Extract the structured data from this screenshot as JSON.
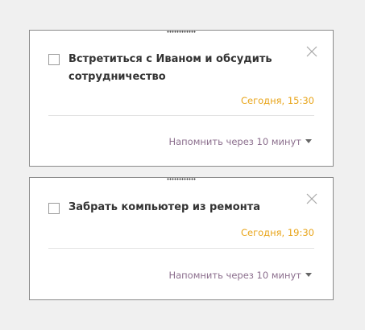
{
  "reminders": [
    {
      "title": "Встретиться с Иваном и обсудить сотрудничество",
      "time": "Сегодня, 15:30",
      "remind_label": "Напомнить через 10 минут",
      "checked": false
    },
    {
      "title": "Забрать компьютер из ремонта",
      "time": "Сегодня, 19:30",
      "remind_label": "Напомнить через 10 минут",
      "checked": false
    }
  ],
  "icons": {
    "close": "close-icon",
    "dropdown": "chevron-down-icon",
    "grip": "drag-handle-icon"
  },
  "colors": {
    "time": "#e8a418",
    "remind": "#8b6e8d",
    "title": "#333333",
    "card_border": "#8a8a8a",
    "background": "#f0f0f0"
  }
}
